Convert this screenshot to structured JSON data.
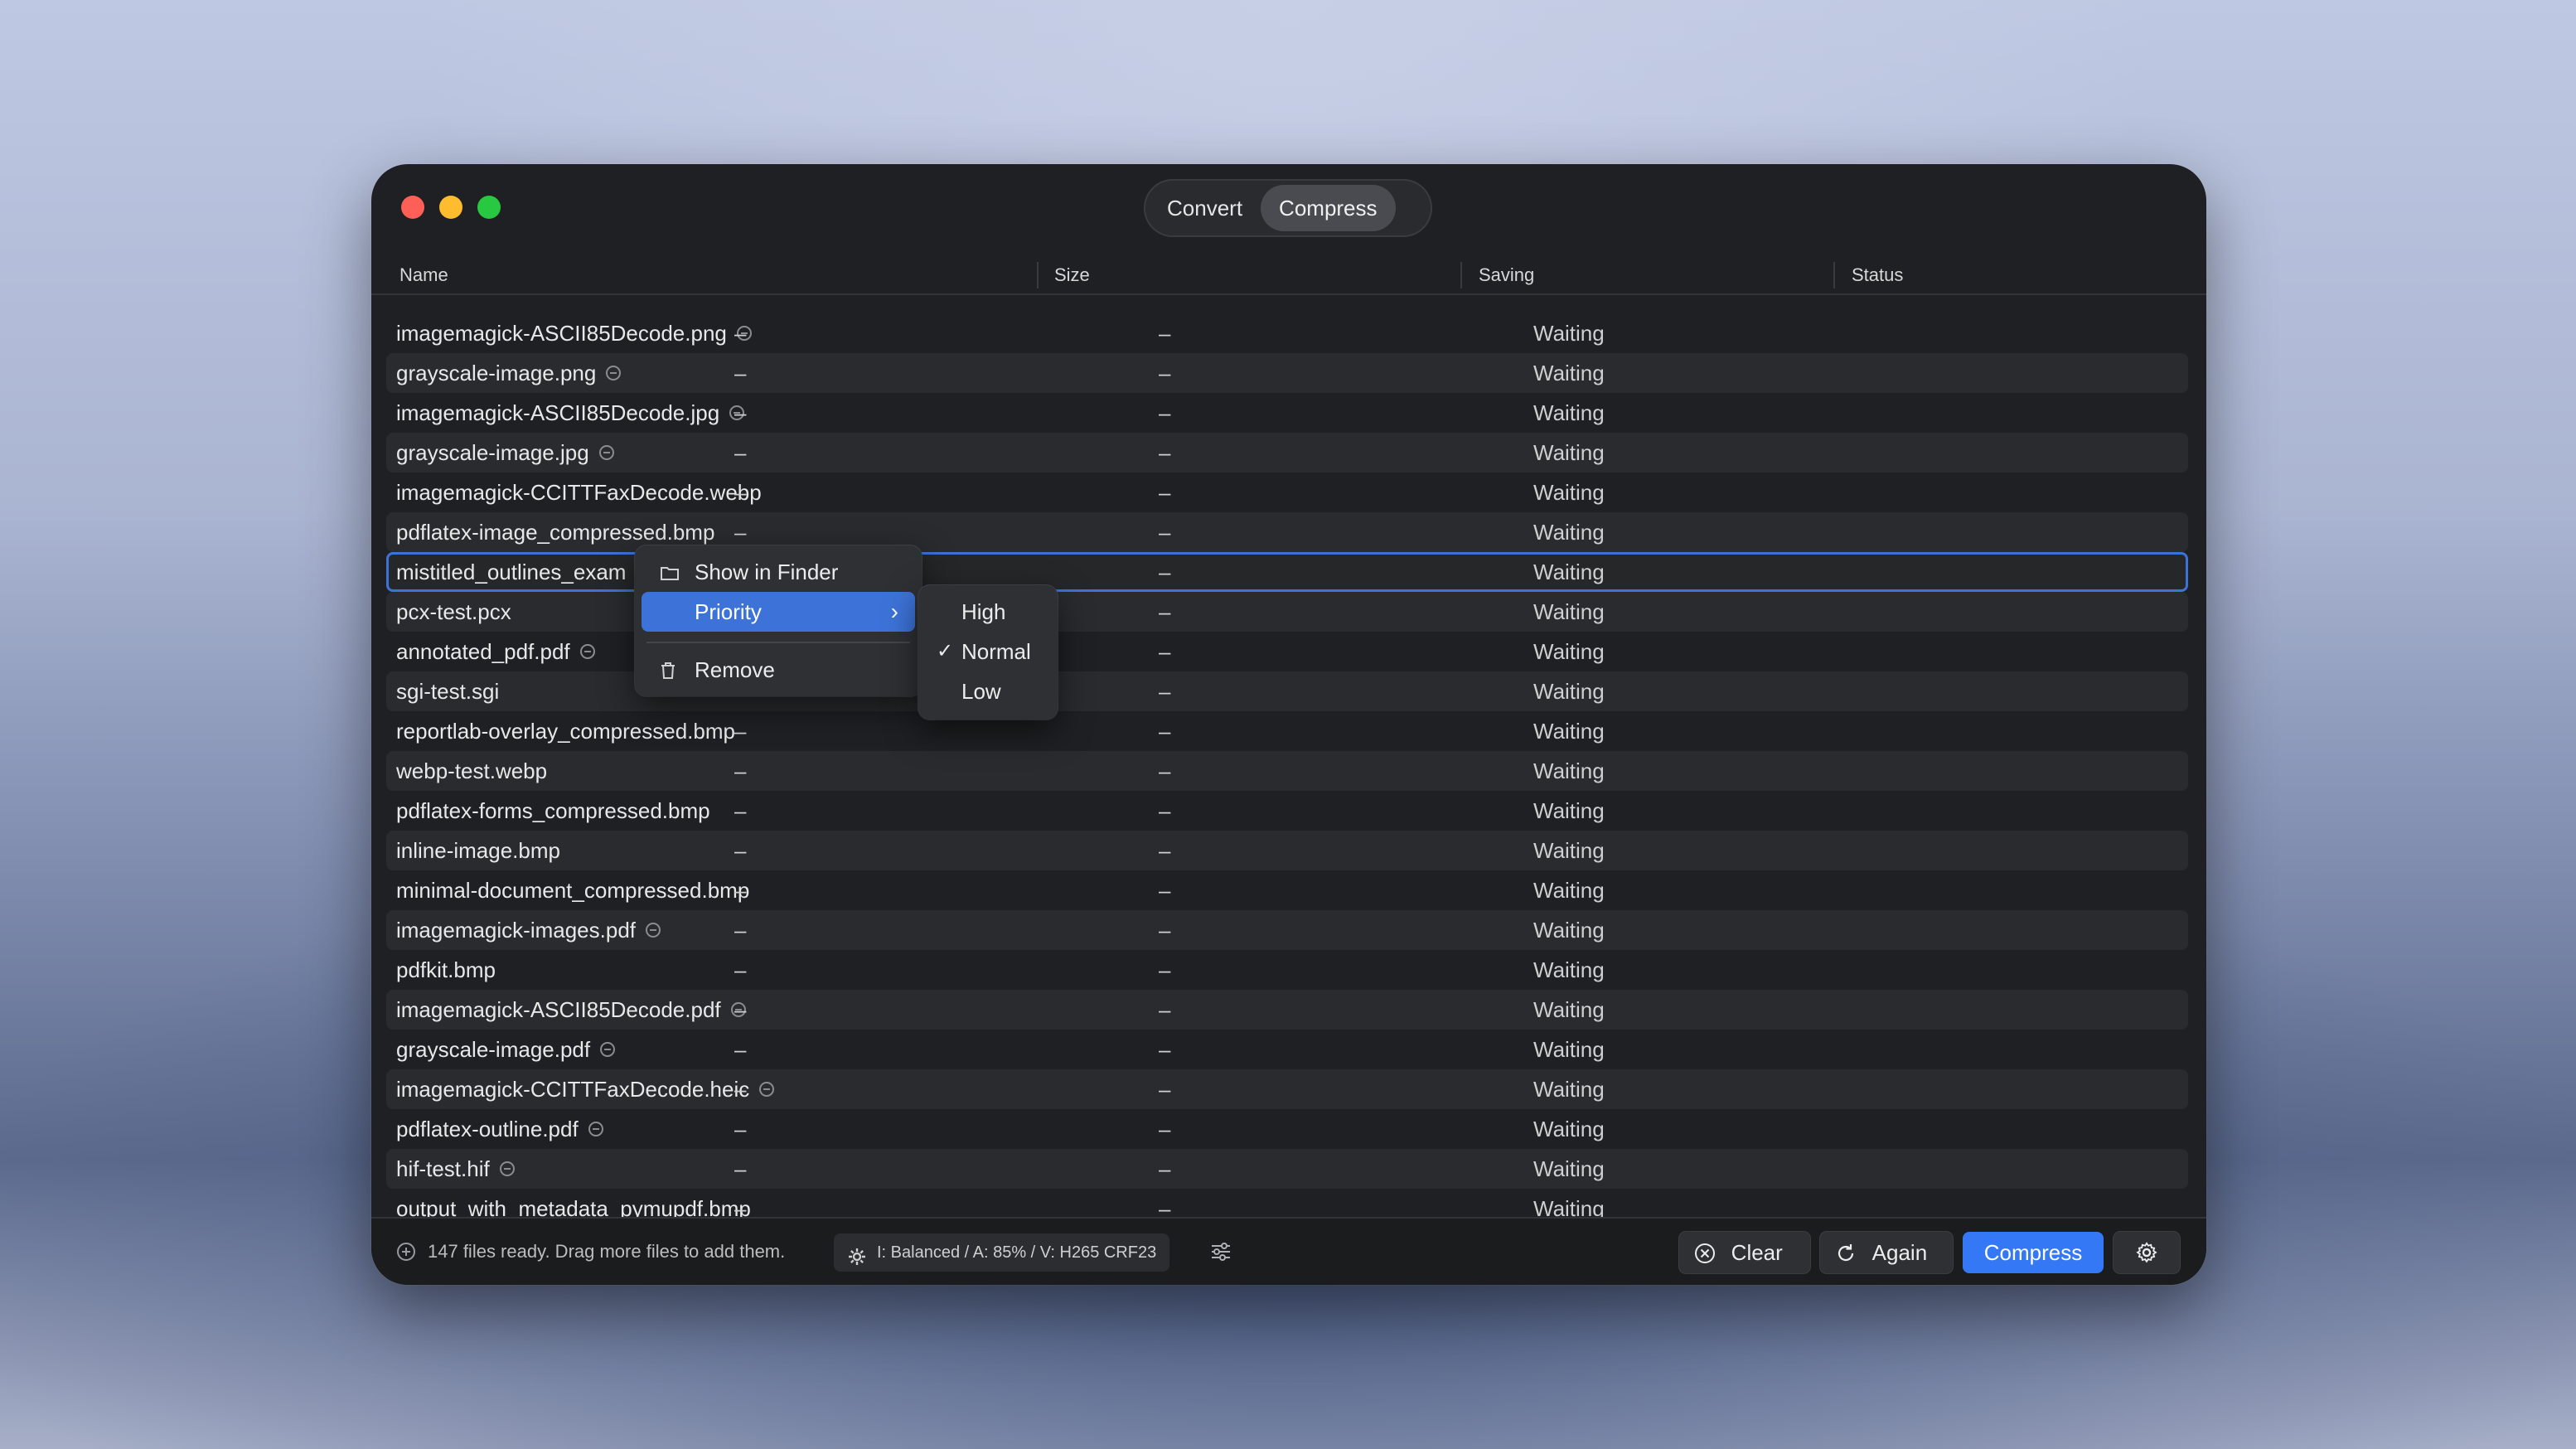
{
  "tabs": [
    {
      "label": "Convert"
    },
    {
      "label": "Compress"
    }
  ],
  "columns": {
    "name": "Name",
    "size": "Size",
    "saving": "Saving",
    "status": "Status"
  },
  "rows": [
    {
      "name": "imagemagick-ASCII85Decode.png",
      "size": "–",
      "saving": "–",
      "status": "Waiting",
      "icon": true
    },
    {
      "name": "grayscale-image.png",
      "size": "–",
      "saving": "–",
      "status": "Waiting",
      "icon": true
    },
    {
      "name": "imagemagick-ASCII85Decode.jpg",
      "size": "–",
      "saving": "–",
      "status": "Waiting",
      "icon": true
    },
    {
      "name": "grayscale-image.jpg",
      "size": "–",
      "saving": "–",
      "status": "Waiting",
      "icon": true
    },
    {
      "name": "imagemagick-CCITTFaxDecode.webp",
      "size": "–",
      "saving": "–",
      "status": "Waiting",
      "icon": false
    },
    {
      "name": "pdflatex-image_compressed.bmp",
      "size": "–",
      "saving": "–",
      "status": "Waiting",
      "icon": false
    },
    {
      "name": "mistitled_outlines_exam",
      "size": "–",
      "saving": "–",
      "status": "Waiting",
      "icon": false
    },
    {
      "name": "pcx-test.pcx",
      "size": "–",
      "saving": "–",
      "status": "Waiting",
      "icon": false
    },
    {
      "name": "annotated_pdf.pdf",
      "size": "–",
      "saving": "–",
      "status": "Waiting",
      "icon": true
    },
    {
      "name": "sgi-test.sgi",
      "size": "–",
      "saving": "–",
      "status": "Waiting",
      "icon": false
    },
    {
      "name": "reportlab-overlay_compressed.bmp",
      "size": "–",
      "saving": "–",
      "status": "Waiting",
      "icon": false
    },
    {
      "name": "webp-test.webp",
      "size": "–",
      "saving": "–",
      "status": "Waiting",
      "icon": false
    },
    {
      "name": "pdflatex-forms_compressed.bmp",
      "size": "–",
      "saving": "–",
      "status": "Waiting",
      "icon": false
    },
    {
      "name": "inline-image.bmp",
      "size": "–",
      "saving": "–",
      "status": "Waiting",
      "icon": false
    },
    {
      "name": "minimal-document_compressed.bmp",
      "size": "–",
      "saving": "–",
      "status": "Waiting",
      "icon": false
    },
    {
      "name": "imagemagick-images.pdf",
      "size": "–",
      "saving": "–",
      "status": "Waiting",
      "icon": true
    },
    {
      "name": "pdfkit.bmp",
      "size": "–",
      "saving": "–",
      "status": "Waiting",
      "icon": false
    },
    {
      "name": "imagemagick-ASCII85Decode.pdf",
      "size": "–",
      "saving": "–",
      "status": "Waiting",
      "icon": true
    },
    {
      "name": "grayscale-image.pdf",
      "size": "–",
      "saving": "–",
      "status": "Waiting",
      "icon": true
    },
    {
      "name": "imagemagick-CCITTFaxDecode.heic",
      "size": "–",
      "saving": "–",
      "status": "Waiting",
      "icon": true
    },
    {
      "name": "pdflatex-outline.pdf",
      "size": "–",
      "saving": "–",
      "status": "Waiting",
      "icon": true
    },
    {
      "name": "hif-test.hif",
      "size": "–",
      "saving": "–",
      "status": "Waiting",
      "icon": true
    },
    {
      "name": "output_with_metadata_pymupdf.bmp",
      "size": "–",
      "saving": "–",
      "status": "Waiting",
      "icon": false
    }
  ],
  "context_menu": {
    "show_in_finder": "Show in Finder",
    "priority": "Priority",
    "remove": "Remove"
  },
  "priority_menu": {
    "high": "High",
    "normal": "Normal",
    "low": "Low",
    "checkmark": "✓"
  },
  "footer": {
    "files_status": "147 files ready. Drag more files to add them.",
    "preset": "I: Balanced / A: 85% / V: H265 CRF23",
    "clear": "Clear",
    "again": "Again",
    "compress": "Compress"
  },
  "icons": {
    "folder": "folder-icon",
    "trash": "trash-icon",
    "chevron": "chevron-right-icon",
    "gear": "gear-icon",
    "sliders": "sliders-icon",
    "plus": "plus-circle-icon",
    "clear": "x-circle-icon",
    "again": "refresh-icon"
  },
  "colors": {
    "accent": "#3478f6",
    "selection": "#3d73d8"
  }
}
